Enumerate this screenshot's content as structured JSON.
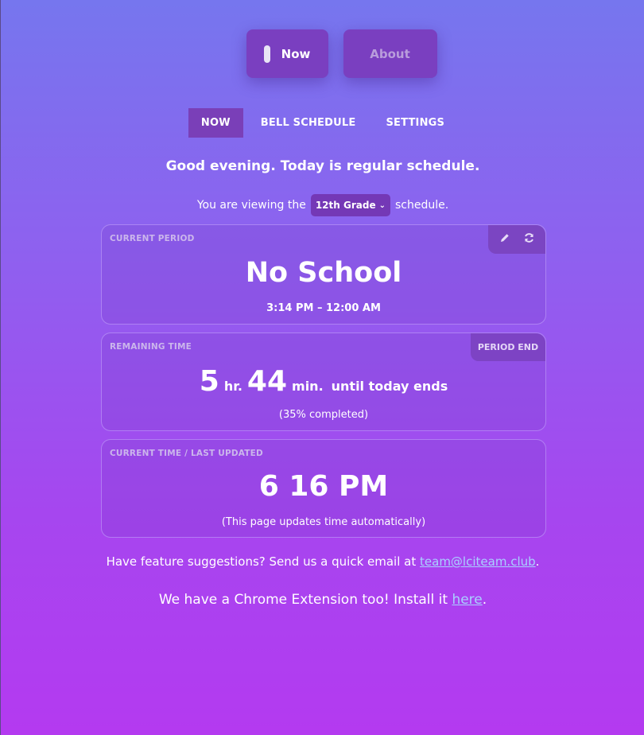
{
  "top_buttons": {
    "now_label": "Now",
    "about_label": "About"
  },
  "tabs": [
    {
      "label": "NOW",
      "active": true
    },
    {
      "label": "BELL SCHEDULE",
      "active": false
    },
    {
      "label": "SETTINGS",
      "active": false
    }
  ],
  "greeting": "Good evening. Today is regular schedule.",
  "viewing": {
    "prefix": "You are viewing the",
    "selected_grade": "12th Grade",
    "suffix": "schedule."
  },
  "current_period": {
    "label": "CURRENT PERIOD",
    "name": "No School",
    "time_range": "3:14 PM – 12:00 AM"
  },
  "remaining": {
    "label": "REMAINING TIME",
    "button": "PERIOD END",
    "hours": "5",
    "hours_unit": "hr.",
    "minutes": "44",
    "minutes_unit": "min.",
    "tail": "until today ends",
    "percent": "(35% completed)"
  },
  "current_time": {
    "label": "CURRENT TIME / LAST UPDATED",
    "value": "6 16 PM",
    "note": "(This page updates time automatically)"
  },
  "footer": {
    "suggest_prefix": "Have feature suggestions? Send us a quick email at",
    "email": "team@lciteam.club",
    "suggest_suffix": ".",
    "ext_prefix": "We have a Chrome Extension too! Install it",
    "ext_link": "here",
    "ext_suffix": "."
  },
  "icons": [
    "pencil-icon",
    "refresh-icon",
    "chevron-down-icon"
  ],
  "colors": {
    "gradient_top": "#7676ee",
    "gradient_bottom": "#b43af0",
    "button_bg": "#7a3fc0",
    "link": "#a9d0ff"
  }
}
